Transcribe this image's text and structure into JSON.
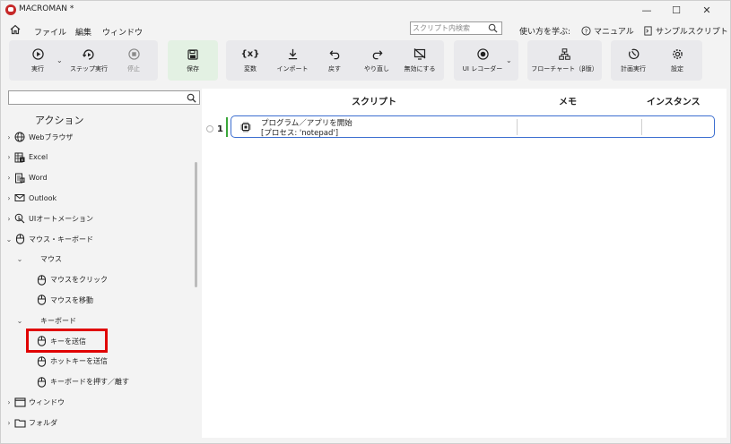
{
  "window": {
    "title": "MACROMAN *",
    "minimize": "—",
    "maximize": "☐",
    "close": "✕"
  },
  "menu": {
    "file": "ファイル",
    "edit": "編集",
    "window": "ウィンドウ"
  },
  "script_search": {
    "placeholder": "スクリプト内検索"
  },
  "help_links": {
    "learn": "使い方を学ぶ:",
    "manual": "マニュアル",
    "samples": "サンプルスクリプト"
  },
  "toolbar": {
    "run": "実行",
    "step_run": "ステップ実行",
    "stop": "停止",
    "save": "保存",
    "variables": "変数",
    "import": "インポート",
    "undo": "戻す",
    "redo": "やり直し",
    "disable": "無効にする",
    "ui_recorder": "UI レコーダー",
    "flowchart": "フローチャート（β版）",
    "schedule": "計画実行",
    "settings": "設定"
  },
  "actions_panel": {
    "title": "アクション",
    "items": [
      {
        "label": "Webブラウザ",
        "icon": "globe-icon",
        "level": 0,
        "arrow": "›"
      },
      {
        "label": "Excel",
        "icon": "excel-icon",
        "level": 0,
        "arrow": "›"
      },
      {
        "label": "Word",
        "icon": "word-icon",
        "level": 0,
        "arrow": "›"
      },
      {
        "label": "Outlook",
        "icon": "mail-icon",
        "level": 0,
        "arrow": "›"
      },
      {
        "label": "UIオートメーション",
        "icon": "cursor-search-icon",
        "level": 0,
        "arrow": "›"
      },
      {
        "label": "マウス・キーボード",
        "icon": "mouse-icon",
        "level": 0,
        "arrow": "⌄"
      },
      {
        "label": "マウス",
        "icon": "",
        "level": 1,
        "arrow": "⌄"
      },
      {
        "label": "マウスをクリック",
        "icon": "mouse-icon",
        "level": 2,
        "arrow": ""
      },
      {
        "label": "マウスを移動",
        "icon": "mouse-icon",
        "level": 2,
        "arrow": ""
      },
      {
        "label": "キーボード",
        "icon": "",
        "level": 1,
        "arrow": "⌄"
      },
      {
        "label": "キーを送信",
        "icon": "mouse-icon",
        "level": 2,
        "arrow": ""
      },
      {
        "label": "ホットキーを送信",
        "icon": "mouse-icon",
        "level": 2,
        "arrow": ""
      },
      {
        "label": "キーボードを押す／離す",
        "icon": "mouse-icon",
        "level": 2,
        "arrow": ""
      },
      {
        "label": "ウィンドウ",
        "icon": "window-icon",
        "level": 0,
        "arrow": "›"
      },
      {
        "label": "フォルダ",
        "icon": "folder-icon",
        "level": 0,
        "arrow": "›"
      }
    ]
  },
  "script_table": {
    "headers": {
      "script": "スクリプト",
      "memo": "メモ",
      "instance": "インスタンス"
    },
    "rows": [
      {
        "num": "1",
        "name": "プログラム／アプリを開始",
        "param": "[プロセス: 'notepad']",
        "memo": "",
        "instance": ""
      }
    ]
  },
  "colors": {
    "highlight": "#e00000",
    "selected_border": "#3c6ed0",
    "row_marker": "#3aa63a",
    "save_bg": "#e3f1e3",
    "toolbar_bg": "#e9e9ec"
  }
}
